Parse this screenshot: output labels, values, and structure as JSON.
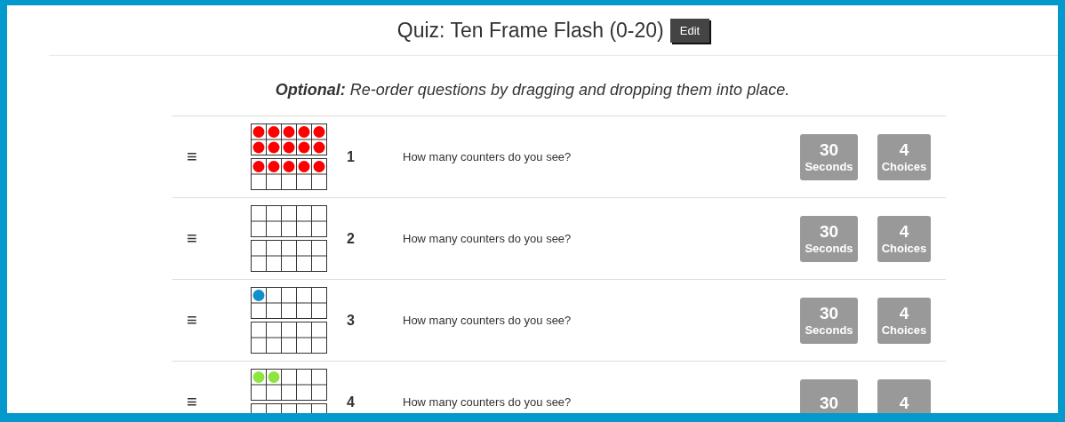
{
  "header": {
    "title": "Quiz: Ten Frame Flash (0-20)",
    "edit_button": "Edit"
  },
  "instructions": "**Optional:** *Re-order questions by dragging and dropping them into place.*",
  "questions": [
    {
      "handle": "≡",
      "counters": [
        {
          "color": "#ff0000"
        },
        {
          "color": "#ff0000"
        },
        {
          "color": "#ff0000"
        },
        {
          "color": "#ff0000"
        },
        {
          "color": "#ff0000"
        },
        {
          "color": "#ff0000"
        },
        {
          "color": "#ff0000"
        },
        {
          "color": "#ff0000"
        },
        {
          "color": "#ff0000"
        },
        {
          "color": "#ff0000"
        },
        {
          "color": "#ff0000"
        },
        {
          "color": "#ff0000"
        },
        {
          "color": "#ff0000"
        },
        {
          "color": "#ff0000"
        },
        {
          "color": "#ff0000"
        }
      ],
      "number": "1",
      "text": "How many counters do you see?",
      "seconds": {
        "value": "30",
        "label": "Seconds"
      },
      "choices": {
        "value": "4",
        "label": "Choices"
      }
    },
    {
      "handle": "≡",
      "number": "2",
      "text": "How many counters do you see?",
      "seconds": {
        "value": "30",
        "label": "Seconds"
      },
      "choices": {
        "value": "4",
        "label": "Choices"
      }
    },
    {
      "handle": "≡",
      "counters": [
        {
          "color": "#0f8fcc"
        }
      ],
      "number": "3",
      "text": "How many counters do you see?",
      "seconds": {
        "value": "30",
        "label": "Seconds"
      },
      "choices": {
        "value": "4",
        "label": "Choices"
      }
    },
    {
      "handle": "≡",
      "counters": [
        {
          "color": "#8ee53f"
        },
        {
          "color": "#8ee53f"
        }
      ],
      "number": "4",
      "text": "How many counters do you see?",
      "seconds": {
        "value": "30"
      },
      "choices": {
        "value": "4"
      }
    }
  ]
}
